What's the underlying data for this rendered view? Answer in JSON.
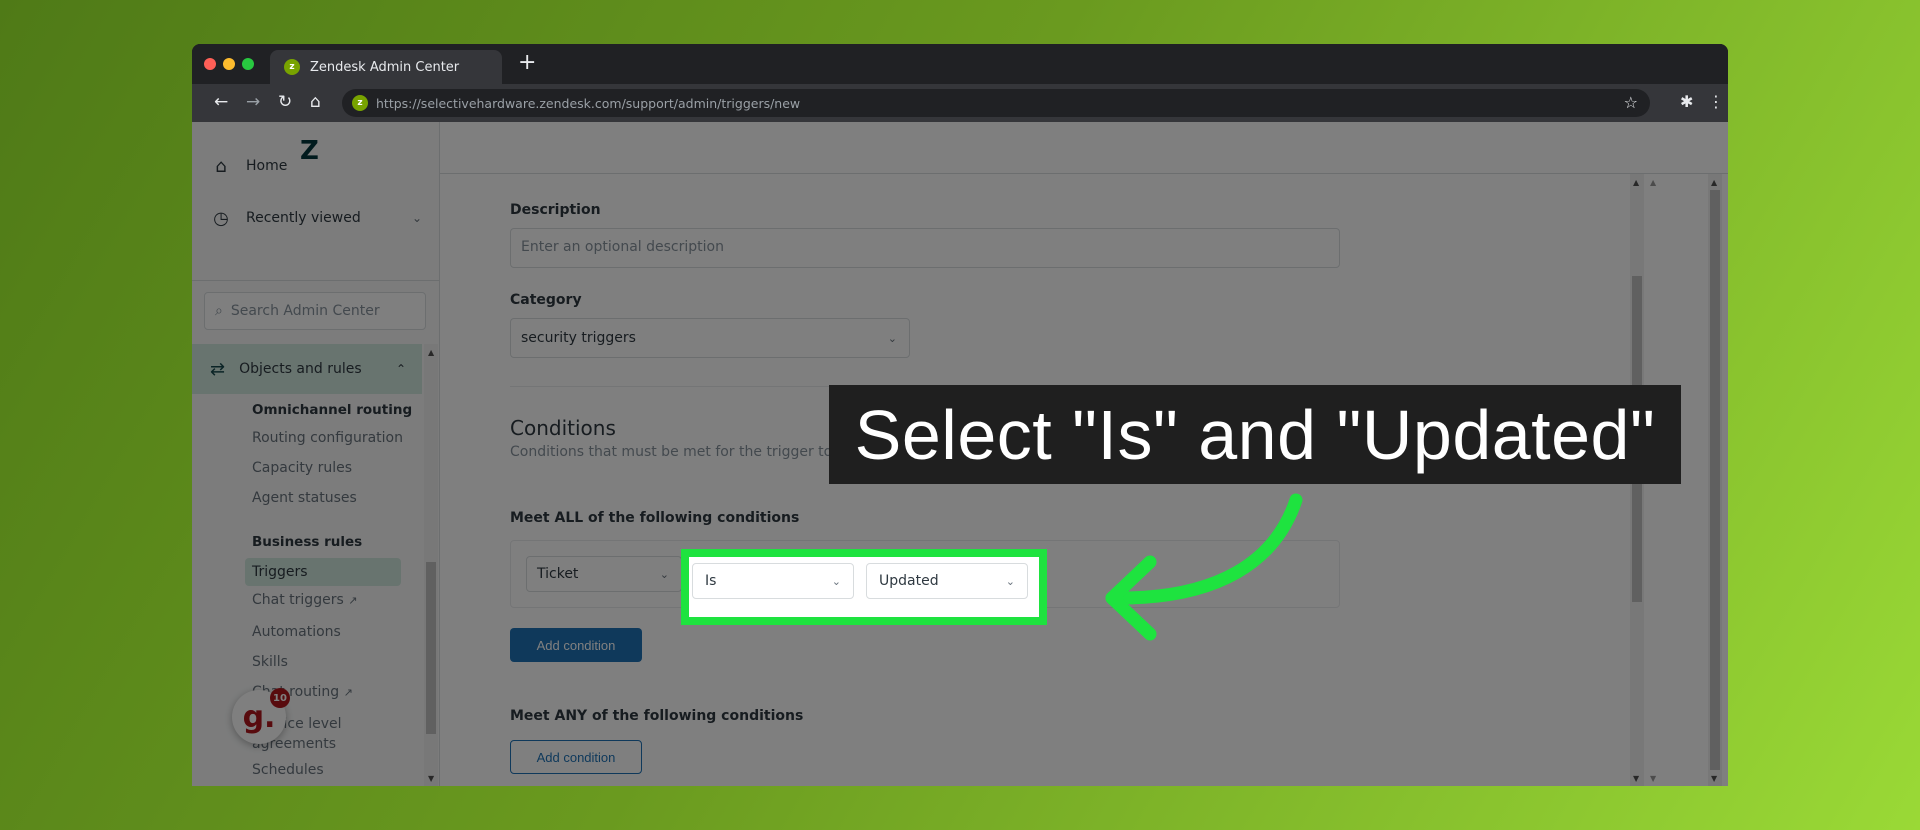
{
  "browser": {
    "tab_title": "Zendesk Admin Center",
    "favicon_letter": "z",
    "new_tab_glyph": "+",
    "url": "https://selectivehardware.zendesk.com/support/admin/triggers/new",
    "icons": {
      "back": "←",
      "forward": "→",
      "reload": "↻",
      "home": "⌂",
      "star": "☆",
      "extensions": "✱",
      "menu": "⋮"
    },
    "traffic_colors": [
      "#ff5f57",
      "#febc2e",
      "#28c840"
    ]
  },
  "sidebar": {
    "logo": "Z",
    "home": "Home",
    "recently_viewed": "Recently viewed",
    "search_placeholder": "Search Admin Center",
    "section": "Objects and rules",
    "groups": [
      {
        "heading": "Omnichannel routing",
        "items": [
          "Routing configuration",
          "Capacity rules",
          "Agent statuses"
        ]
      },
      {
        "heading": "Business rules",
        "items": [
          "Triggers",
          "Chat triggers",
          "Automations",
          "Skills",
          "Chat routing",
          "Service level agreements",
          "Schedules"
        ]
      }
    ],
    "active_item": "Triggers",
    "external_items": [
      "Chat triggers",
      "Chat routing"
    ],
    "widget_badge_letter": "g.",
    "widget_badge_count": "10"
  },
  "topbar": {
    "icons": [
      "products-grid-icon",
      "help-icon",
      "user-avatar-icon"
    ]
  },
  "form": {
    "description_label": "Description",
    "description_placeholder": "Enter an optional description",
    "category_label": "Category",
    "category_value": "security triggers",
    "conditions_title": "Conditions",
    "conditions_hint": "Conditions that must be met for the trigger to run",
    "all_label": "Meet ALL of the following conditions",
    "all_condition": {
      "field": "Ticket",
      "operator": "Is",
      "value": "Updated"
    },
    "add_condition_all": "Add condition",
    "any_label": "Meet ANY of the following conditions",
    "add_condition_any": "Add condition"
  },
  "annotation": {
    "caption": "Select \"Is\" and \"Updated\"",
    "highlight_color": "#1ee33f"
  }
}
